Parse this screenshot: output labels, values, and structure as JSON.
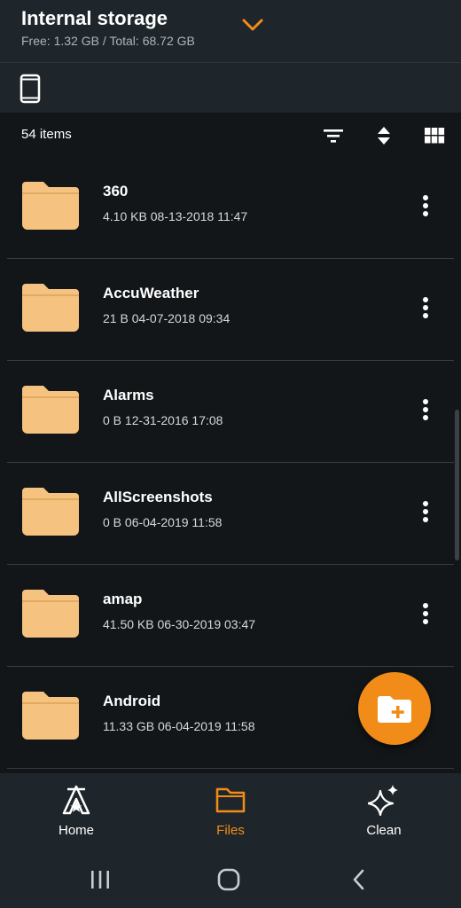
{
  "header": {
    "title": "Internal storage",
    "subtitle": "Free: 1.32 GB / Total: 68.72 GB",
    "dropdown_icon": "chevron-down-icon"
  },
  "device_bar": {
    "icon": "phone-icon"
  },
  "toolbar": {
    "count": "54 items",
    "filter_icon": "filter-icon",
    "sort_icon": "sort-icon",
    "grid_icon": "grid-view-icon"
  },
  "files": [
    {
      "name": "360",
      "meta": "4.10 KB 08-13-2018 11:47"
    },
    {
      "name": "AccuWeather",
      "meta": "21 B 04-07-2018 09:34"
    },
    {
      "name": "Alarms",
      "meta": "0 B 12-31-2016 17:08"
    },
    {
      "name": "AllScreenshots",
      "meta": "0 B 06-04-2019 11:58"
    },
    {
      "name": "amap",
      "meta": "41.50 KB 06-30-2019 03:47"
    },
    {
      "name": "Android",
      "meta": "11.33 GB 06-04-2019 11:58"
    }
  ],
  "fab": {
    "icon": "new-folder-icon"
  },
  "bottom_nav": {
    "home": "Home",
    "files": "Files",
    "clean": "Clean"
  },
  "colors": {
    "background": "#121619",
    "bar": "#1f262b",
    "accent": "#f28c18",
    "folder": "#f5c27f"
  }
}
